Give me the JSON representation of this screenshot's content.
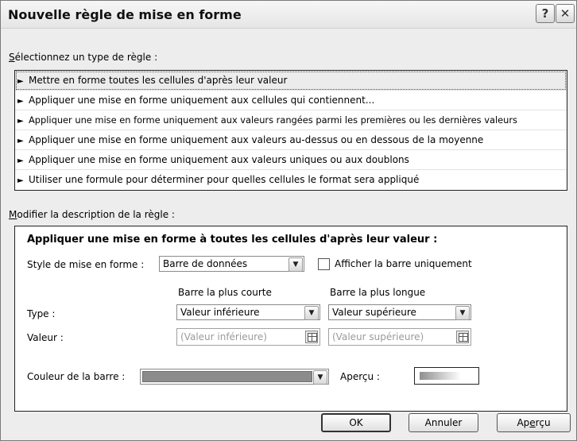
{
  "dialog": {
    "title": "Nouvelle règle de mise en forme",
    "help_label": "?",
    "close_label": "✕"
  },
  "rule_type": {
    "label_mnemonic": "S",
    "label_rest": "électionnez un type de règle :",
    "items": [
      {
        "label": "Mettre en forme toutes les cellules d'après leur valeur",
        "selected": true
      },
      {
        "label": "Appliquer une mise en forme uniquement aux cellules qui contiennent...",
        "selected": false
      },
      {
        "label": "Appliquer une mise en forme uniquement aux valeurs rangées parmi les premières ou les dernières valeurs",
        "selected": false
      },
      {
        "label": "Appliquer une mise en forme uniquement aux valeurs au-dessus ou en dessous de la moyenne",
        "selected": false
      },
      {
        "label": "Appliquer une mise en forme uniquement aux valeurs uniques ou aux doublons",
        "selected": false
      },
      {
        "label": "Utiliser une formule pour déterminer pour quelles cellules le format sera appliqué",
        "selected": false
      }
    ],
    "arrow_glyph": "►"
  },
  "description": {
    "label_mnemonic": "M",
    "label_rest": "odifier la description de la règle :",
    "panel_title": "Appliquer une mise en forme à toutes les cellules d'après leur valeur :",
    "style_label": "Style de mise en forme :",
    "style_value": "Barre de données",
    "show_bar_only_label": "Afficher la barre uniquement",
    "show_bar_only_checked": false,
    "shortest_bar_header": "Barre la plus courte",
    "longest_bar_header": "Barre la plus longue",
    "type_label": "Type :",
    "type_min_value": "Valeur inférieure",
    "type_max_value": "Valeur supérieure",
    "value_label": "Valeur :",
    "value_min_placeholder": "(Valeur inférieure)",
    "value_max_placeholder": "(Valeur supérieure)",
    "bar_color_label": "Couleur de la barre :",
    "bar_color": "#8c8c8c",
    "preview_label": "Aperçu :"
  },
  "buttons": {
    "ok": "OK",
    "cancel": "Annuler",
    "preview_mnemonic_pre": "Ap",
    "preview_mnemonic": "e",
    "preview_post": "rçu"
  },
  "icons": {
    "dropdown": "chevron-down-icon",
    "range_selector": "range-selector-icon"
  }
}
